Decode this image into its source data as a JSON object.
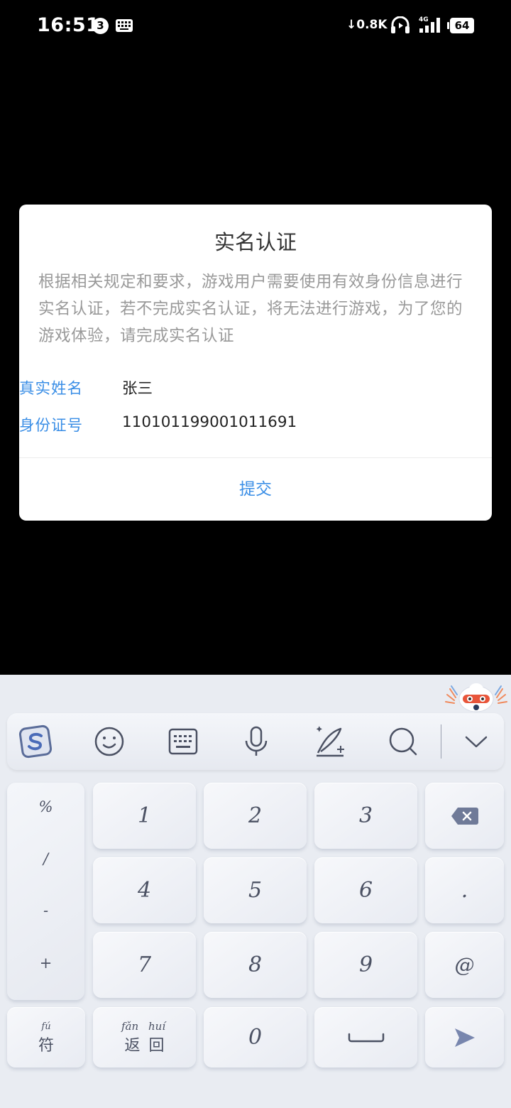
{
  "status_bar": {
    "time": "16:51",
    "notification_count": "3",
    "net_speed": "0.8K",
    "network_type": "4G",
    "battery": "64"
  },
  "dialog": {
    "title": "实名认证",
    "description": "根据相关规定和要求，游戏用户需要使用有效身份信息进行实名认证，若不完成实名认证，将无法进行游戏，为了您的游戏体验，请完成实名认证",
    "name_label": "真实姓名",
    "name_value": "张三",
    "id_label": "身份证号",
    "id_value": "110101199001011691",
    "submit_label": "提交"
  },
  "keyboard": {
    "toolbar_icons": [
      "sogou-logo-icon",
      "emoji-icon",
      "keyboard-icon",
      "microphone-icon",
      "handwriting-icon",
      "search-icon",
      "chevron-down-icon"
    ],
    "symbols": [
      "%",
      "/",
      "-",
      "+"
    ],
    "digits": [
      "1",
      "2",
      "3",
      "4",
      "5",
      "6",
      "7",
      "8",
      "9",
      "0"
    ],
    "dot_key": ".",
    "at_key": "@",
    "fu_key": {
      "char": "符",
      "pinyin": "fú"
    },
    "back_key": {
      "chars": "返回",
      "pinyin_1": "fǎn",
      "pinyin_2": "huí"
    },
    "accent_color": "#3a8ee6"
  }
}
